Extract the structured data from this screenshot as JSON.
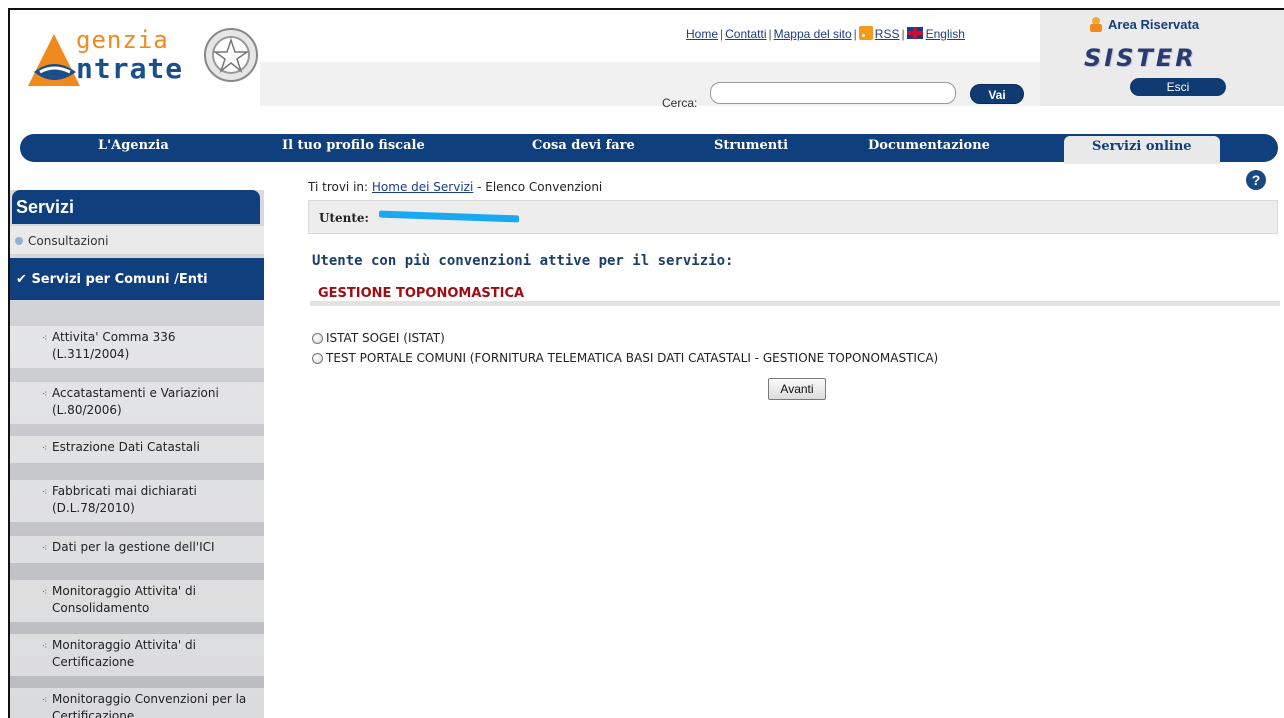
{
  "header": {
    "logo": {
      "line1": "genzia",
      "line2": "ntrate"
    },
    "top_links": [
      "Home",
      "Contatti",
      "Mappa del sito",
      "RSS",
      "English"
    ],
    "search": {
      "label": "Cerca:",
      "value": "",
      "button": "Vai"
    },
    "area_riservata": {
      "title": "Area Riservata",
      "brand": "SISTER",
      "exit": "Esci"
    }
  },
  "nav": {
    "items": [
      "L'Agenzia",
      "Il tuo profilo fiscale",
      "Cosa devi fare",
      "Strumenti",
      "Documentazione",
      "Servizi online"
    ],
    "active": "Servizi online"
  },
  "sidebar": {
    "title": "Servizi",
    "consult": "Consultazioni",
    "active_section": "Servizi per Comuni /Enti",
    "items": [
      {
        "line1": "Attivita' Comma 336",
        "line2": "(L.311/2004)"
      },
      {
        "line1": "Accatastamenti e Variazioni",
        "line2": "(L.80/2006)"
      },
      {
        "line1": "Estrazione Dati Catastali",
        "line2": ""
      },
      {
        "line1": "Fabbricati mai dichiarati",
        "line2": "(D.L.78/2010)"
      },
      {
        "line1": "Dati per la gestione dell'ICI",
        "line2": ""
      },
      {
        "line1": "Monitoraggio Attivita' di",
        "line2": "Consolidamento"
      },
      {
        "line1": "Monitoraggio Attivita' di",
        "line2": "Certificazione"
      },
      {
        "line1": "Monitoraggio Convenzioni per la",
        "line2": "Certificazione"
      }
    ]
  },
  "content": {
    "breadcrumb": {
      "prefix": "Ti trovi in:",
      "link": "Home dei Servizi",
      "current": "- Elenco Convenzioni"
    },
    "user_label": "Utente:",
    "section_title": "Utente con più convenzioni attive per il servizio:",
    "service_name": "GESTIONE TOPONOMASTICA",
    "options": [
      "ISTAT SOGEI (ISTAT)",
      "TEST PORTALE COMUNI (FORNITURA TELEMATICA BASI DATI CATASTALI - GESTIONE TOPONOMASTICA)"
    ],
    "submit": "Avanti"
  },
  "colors": {
    "brand_blue": "#0f3f7c",
    "service_red": "#a10d12",
    "logo_orange": "#f08a1e"
  }
}
